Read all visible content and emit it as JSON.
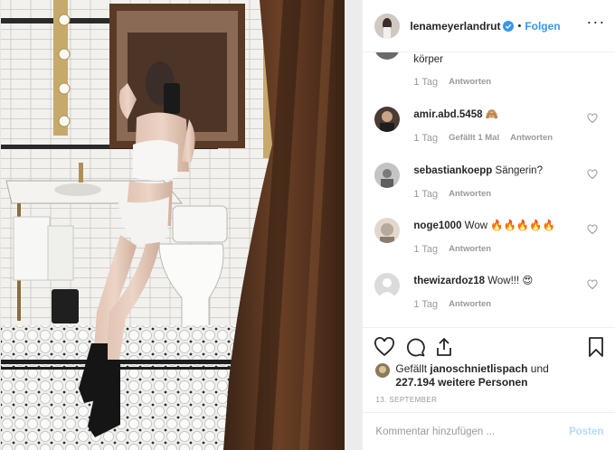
{
  "header": {
    "username": "lenameyerlandrut",
    "dot": "•",
    "follow_label": "Folgen",
    "more_label": "···"
  },
  "comments": [
    {
      "username": "",
      "text": "körper",
      "age": "1 Tag",
      "likes": "",
      "reply_label": "Antworten",
      "avatar_color": "#6a6a6a"
    },
    {
      "username": "amir.abd.5458",
      "text": "🙈",
      "age": "1 Tag",
      "likes": "Gefällt 1 Mal",
      "reply_label": "Antworten",
      "avatar_color": "#4a3b33"
    },
    {
      "username": "sebastiankoepp",
      "text": "Sängerin?",
      "age": "1 Tag",
      "likes": "",
      "reply_label": "Antworten",
      "avatar_color": "#9a9a9a"
    },
    {
      "username": "noge1000",
      "text": "Wow 🔥🔥🔥🔥🔥",
      "age": "1 Tag",
      "likes": "",
      "reply_label": "Antworten",
      "avatar_color": "#b8a99a"
    },
    {
      "username": "thewizardoz18",
      "text": "Wow!!! 😍",
      "age": "1 Tag",
      "likes": "",
      "reply_label": "Antworten",
      "avatar_color": "#dbdbdb"
    }
  ],
  "likes": {
    "prefix": "Gefällt ",
    "liker": "janoschnietlispach",
    "connector": " und",
    "count": "227.194 weitere Personen"
  },
  "date": "13. SEPTEMBER",
  "comment_box": {
    "placeholder": "Kommentar hinzufügen ...",
    "post_label": "Posten"
  },
  "colors": {
    "accent": "#3897f0",
    "post_disabled": "#b3dbff",
    "muted": "#999999"
  },
  "icons": [
    "verified-badge-icon",
    "more-options-icon",
    "heart-icon",
    "comment-icon",
    "share-icon",
    "bookmark-icon"
  ]
}
